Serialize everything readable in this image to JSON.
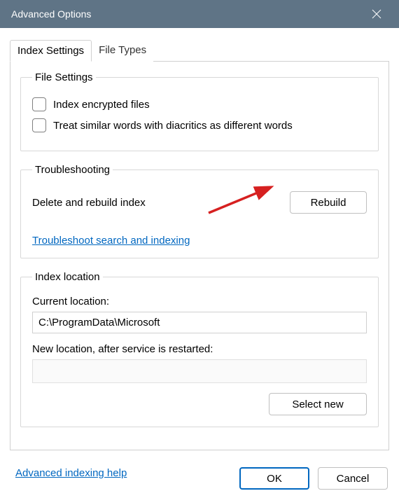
{
  "window": {
    "title": "Advanced Options"
  },
  "tabs": {
    "index_settings": "Index Settings",
    "file_types": "File Types"
  },
  "file_settings": {
    "legend": "File Settings",
    "index_encrypted": "Index encrypted files",
    "treat_diacritics": "Treat similar words with diacritics as different words"
  },
  "troubleshooting": {
    "legend": "Troubleshooting",
    "delete_rebuild": "Delete and rebuild index",
    "rebuild_button": "Rebuild",
    "troubleshoot_link": "Troubleshoot search and indexing"
  },
  "index_location": {
    "legend": "Index location",
    "current_label": "Current location:",
    "current_value": "C:\\ProgramData\\Microsoft",
    "new_label": "New location, after service is restarted:",
    "new_value": "",
    "select_new": "Select new"
  },
  "links": {
    "advanced_help": "Advanced indexing help"
  },
  "buttons": {
    "ok": "OK",
    "cancel": "Cancel"
  }
}
